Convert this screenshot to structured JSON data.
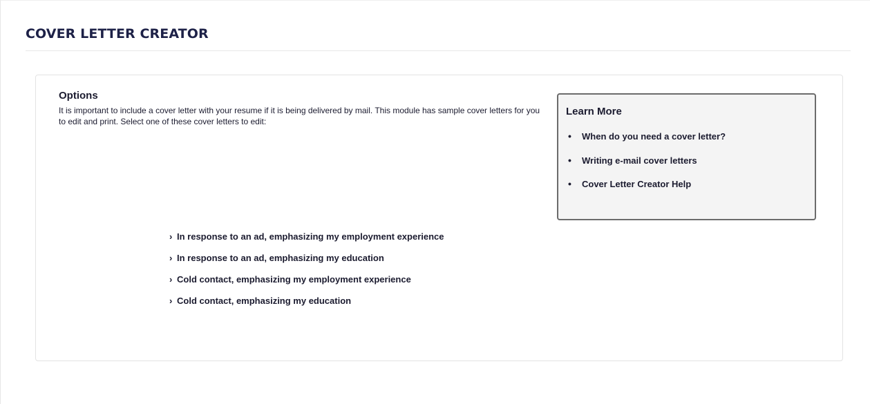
{
  "page": {
    "title": "COVER LETTER CREATOR"
  },
  "options": {
    "heading": "Options",
    "description": "It is important to include a cover letter with your resume if it is being delivered by mail. This module has sample cover letters for you to edit and print. Select one of these cover letters to edit:",
    "items": [
      {
        "label": "In response to an ad, emphasizing my employment experience"
      },
      {
        "label": "In response to an ad, emphasizing my education"
      },
      {
        "label": "Cold contact, emphasizing my employment experience"
      },
      {
        "label": "Cold contact, emphasizing my education"
      }
    ]
  },
  "learn_more": {
    "heading": "Learn More",
    "links": [
      {
        "label": "When do you need a cover letter?"
      },
      {
        "label": "Writing e-mail cover letters"
      },
      {
        "label": "Cover Letter Creator Help"
      }
    ]
  },
  "icons": {
    "option_marker": "chevron-right-icon",
    "link_marker": "bullet-icon"
  },
  "colors": {
    "title": "#1d2147",
    "text": "#1b1b2f",
    "learn_box_background": "#f4f4f4",
    "learn_box_border": "#6b6b6b"
  }
}
